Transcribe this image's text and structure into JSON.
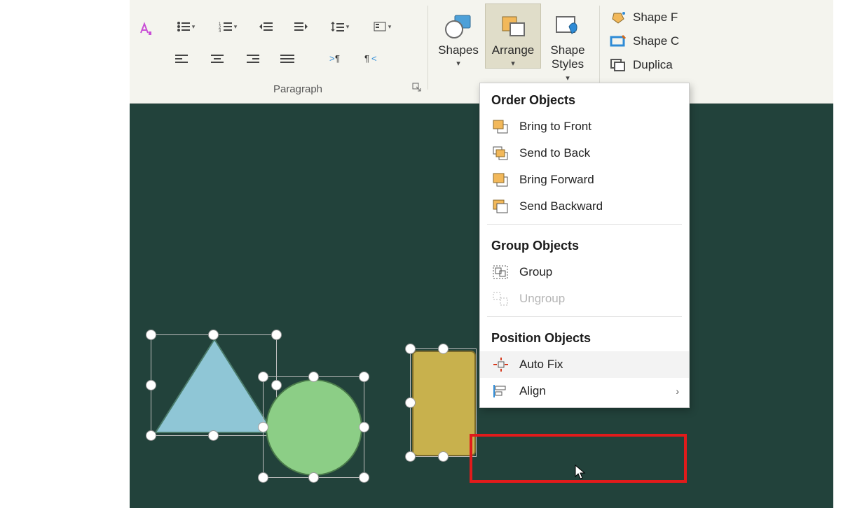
{
  "ribbon": {
    "paragraph_label": "Paragraph",
    "shapes_label": "Shapes",
    "arrange_label": "Arrange",
    "shape_styles_label": "Shape\nStyles",
    "shape_fill_label": "Shape F",
    "shape_outline_label": "Shape C",
    "duplicate_label": "Duplica"
  },
  "menu": {
    "order_header": "Order Objects",
    "bring_front": "Bring to Front",
    "send_back": "Send to Back",
    "bring_forward": "Bring Forward",
    "send_backward": "Send Backward",
    "group_header": "Group Objects",
    "group": "Group",
    "ungroup": "Ungroup",
    "position_header": "Position Objects",
    "auto_fix": "Auto Fix",
    "align": "Align"
  },
  "colors": {
    "triangle": "#8fc6d6",
    "circle": "#8cce86",
    "rect": "#c8b14d",
    "shape_stroke": "#567a6a"
  }
}
